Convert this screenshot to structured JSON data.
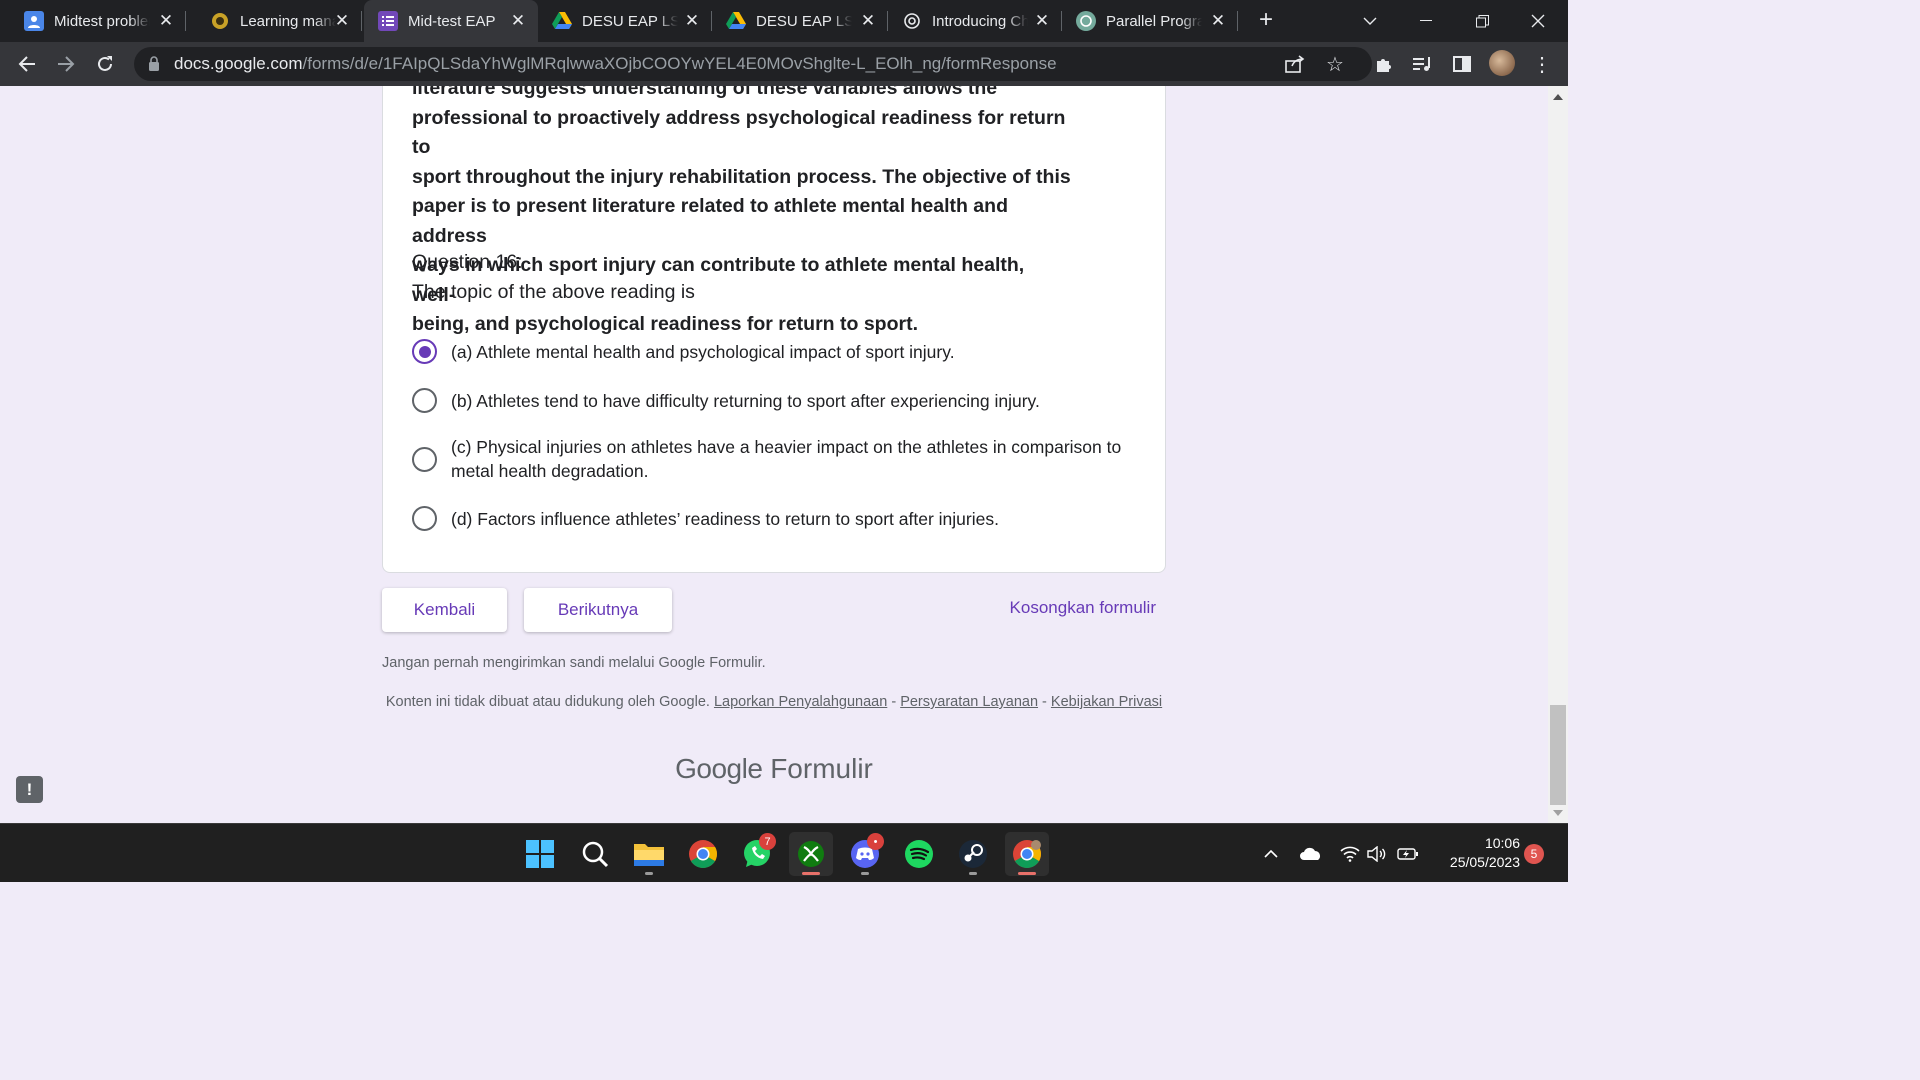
{
  "browser": {
    "tabs": [
      {
        "title": "Midtest problem",
        "icon": "user-profile-icon",
        "active": false
      },
      {
        "title": "Learning manag",
        "icon": "university-emblem-icon",
        "active": false
      },
      {
        "title": "Mid-test EAP",
        "icon": "google-forms-icon",
        "active": true
      },
      {
        "title": "DESU EAP LS M",
        "icon": "google-drive-icon",
        "active": false
      },
      {
        "title": "DESU EAP LS M",
        "icon": "google-drive-icon",
        "active": false
      },
      {
        "title": "Introducing Ch",
        "icon": "openai-icon",
        "active": false
      },
      {
        "title": "Parallel Program",
        "icon": "openai-icon",
        "active": false
      }
    ],
    "address": {
      "host": "docs.google.com",
      "path": "/forms/d/e/1FAIpQLSdaYhWglMRqlwwaXOjbCOOYwYEL4E0MOvShglte-L_EOlh_ng/formResponse"
    }
  },
  "form": {
    "passage_lines": [
      "literature suggests understanding of these variables allows the",
      "professional to proactively address psychological readiness for return to",
      "sport throughout the injury rehabilitation process. The objective of this",
      "paper is to present literature related to athlete mental health and address",
      "ways in which sport injury can contribute to athlete mental health, well-",
      "being, and psychological readiness for return to sport."
    ],
    "question_number": "Question 16:",
    "question_text": "The topic of the above reading is",
    "options": [
      {
        "label": "(a) Athlete mental health and psychological impact of sport injury.",
        "selected": true
      },
      {
        "label": "(b) Athletes tend to have difficulty returning to sport after experiencing injury.",
        "selected": false
      },
      {
        "label": "(c) Physical injuries on athletes have a heavier impact on the athletes in comparison to metal health degradation.",
        "selected": false
      },
      {
        "label": "(d) Factors influence athletes’ readiness to return to sport after injuries.",
        "selected": false
      }
    ],
    "back_button": "Kembali",
    "next_button": "Berikutnya",
    "clear_link": "Kosongkan formulir",
    "password_notice": "Jangan pernah mengirimkan sandi melalui Google Formulir.",
    "disclaimer_text": "Konten ini tidak dibuat atau didukung oleh Google.",
    "report_link": "Laporkan Penyalahgunaan",
    "terms_link": "Persyaratan Layanan",
    "privacy_link": "Kebijakan Privasi",
    "brand_google": "Google",
    "brand_product": "Formulir",
    "accent_color": "#673ab7"
  },
  "taskbar": {
    "apps": [
      {
        "name": "start-icon"
      },
      {
        "name": "search-icon"
      },
      {
        "name": "file-explorer-icon"
      },
      {
        "name": "chrome-icon"
      },
      {
        "name": "whatsapp-icon",
        "badge": "7"
      },
      {
        "name": "xbox-icon"
      },
      {
        "name": "discord-icon",
        "badge": "•"
      },
      {
        "name": "spotify-icon"
      },
      {
        "name": "steam-icon"
      },
      {
        "name": "chrome-profile-icon"
      }
    ],
    "time": "10:06",
    "date": "25/05/2023",
    "notification_count": "5"
  }
}
